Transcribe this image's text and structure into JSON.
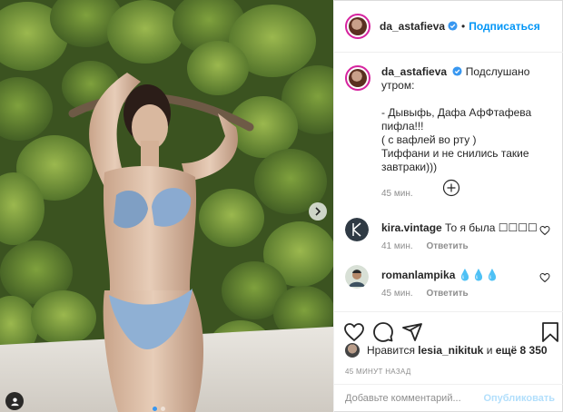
{
  "post": {
    "author": "da_astafieva",
    "follow_label": "Подписаться",
    "separator": "•",
    "caption_lines": [
      "Подслушано утром:",
      "",
      "- Дывыфь, Дафа АфФтафева пифла!!!",
      "( с вафлей во рту )",
      "Тиффани и не снились такие",
      "завтраки)))"
    ],
    "caption_time": "45 мин.",
    "likes_prefix": "Нравится",
    "likes_user": "lesia_nikituk",
    "likes_mid": "и",
    "likes_count": "ещё 8 350",
    "posted_ago": "45 МИНУТ НАЗАД"
  },
  "comments": [
    {
      "user": "kira.vintage",
      "text": "То я была ☐☐☐☐",
      "time": "41 мин.",
      "reply": "Ответить"
    },
    {
      "user": "romanlampika",
      "text": "💧💧💧",
      "time": "45 мин.",
      "reply": "Ответить"
    }
  ],
  "composer": {
    "placeholder": "Добавьте комментарий...",
    "publish_label": "Опубликовать"
  },
  "colors": {
    "accent": "#0095f6",
    "publish_disabled": "#b2dffc",
    "muted": "#8e8e8e"
  },
  "icons": [
    "verified-badge-icon",
    "add-circle-icon",
    "heart-icon",
    "comment-icon",
    "share-icon",
    "bookmark-icon",
    "chevron-right-icon",
    "user-tag-icon"
  ]
}
